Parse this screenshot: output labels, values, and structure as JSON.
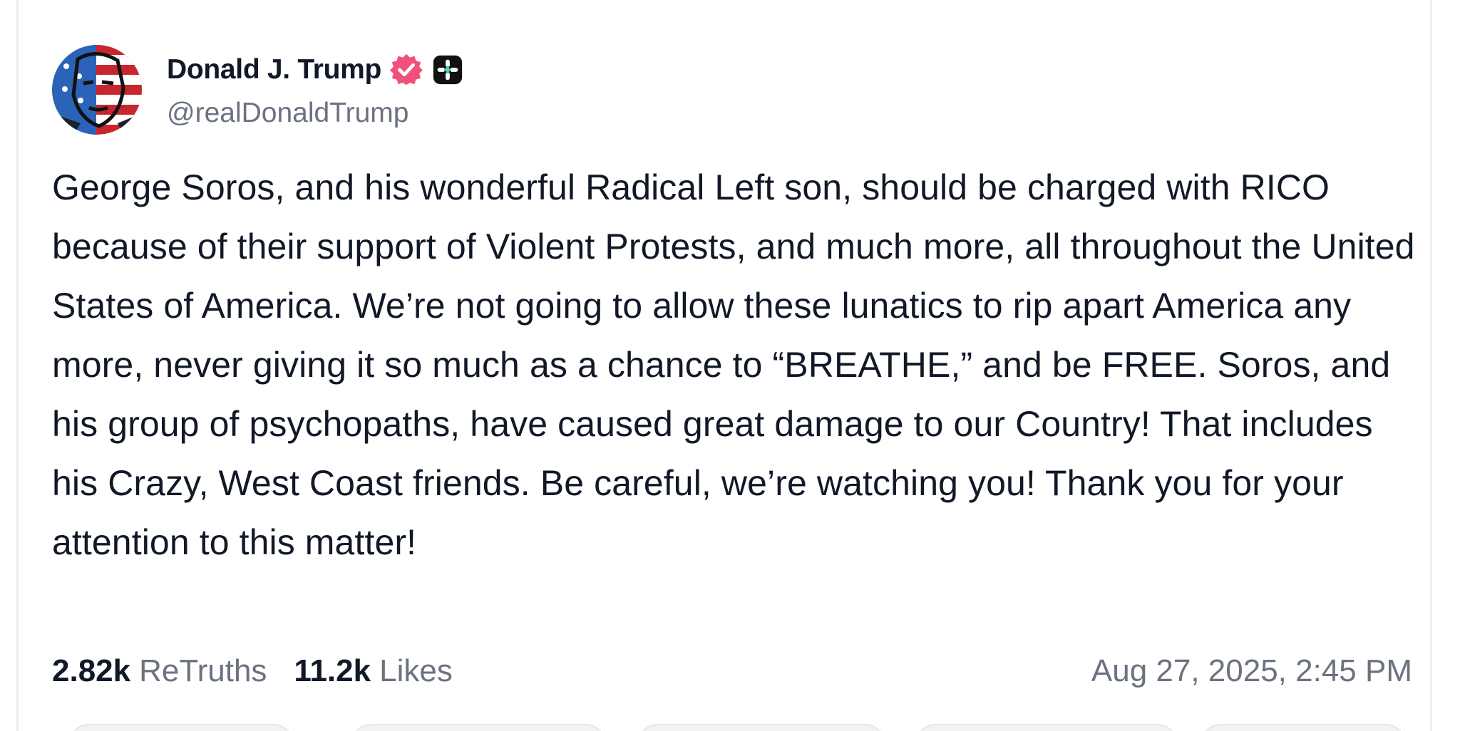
{
  "author": {
    "display_name": "Donald J. Trump",
    "handle": "@realDonaldTrump",
    "avatar_icon": "flag-portrait-avatar",
    "verified_icon": "verified-badge-icon",
    "plus_icon": "truth-plus-badge-icon"
  },
  "post": {
    "text": "George Soros, and his wonderful Radical Left son, should be charged with RICO because of their support of Violent Protests, and much more, all throughout the United States of America. We’re not going to allow these lunatics to rip apart America any more, never giving it so much as a chance to “BREATHE,” and be FREE. Soros, and his group of psychopaths, have caused great damage to our Country! That includes his Crazy, West Coast friends. Be careful, we’re watching you! Thank you for your attention to this matter!"
  },
  "stats": {
    "retruths_value": "2.82k",
    "retruths_label": "ReTruths",
    "likes_value": "11.2k",
    "likes_label": "Likes",
    "timestamp": "Aug 27, 2025, 2:45 PM"
  },
  "colors": {
    "verified": "#f0507a",
    "text": "#111827",
    "muted": "#6b7280"
  }
}
